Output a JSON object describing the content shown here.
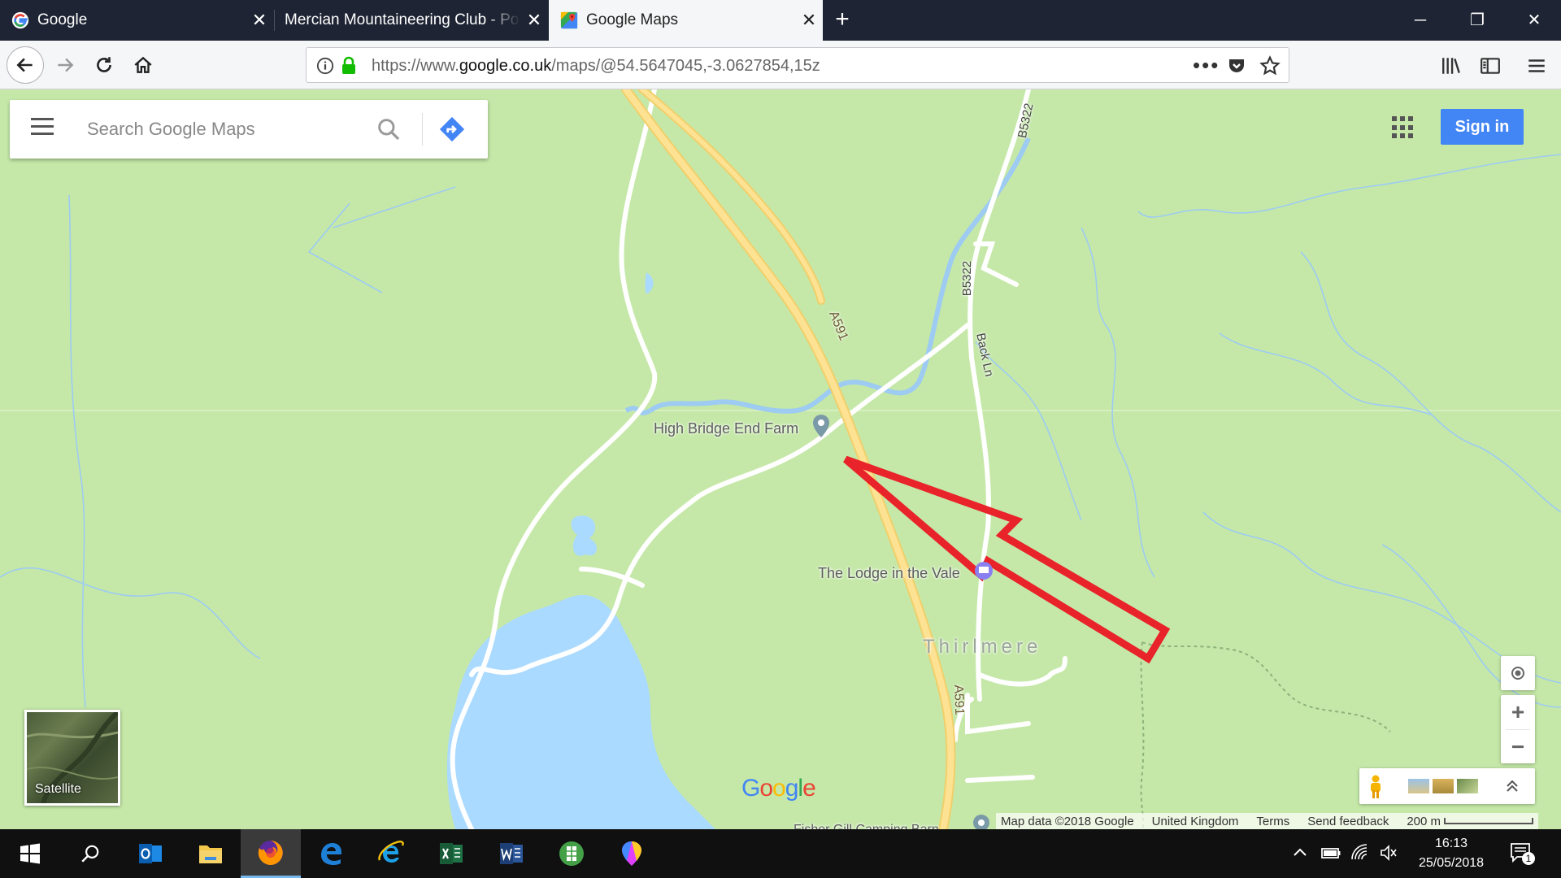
{
  "browser": {
    "tabs": [
      {
        "title": "Google",
        "favicon": "google-g-icon",
        "active": false
      },
      {
        "title": "Mercian Mountaineering Club - Pos",
        "favicon": "none",
        "active": false
      },
      {
        "title": "Google Maps",
        "favicon": "google-maps-icon",
        "active": true
      }
    ],
    "url_prefix": "https://www.",
    "url_domain": "google.co.uk",
    "url_path": "/maps/@54.5647045,-3.0627854,15z"
  },
  "maps": {
    "search_placeholder": "Search Google Maps",
    "sign_in": "Sign in",
    "satellite_label": "Satellite",
    "logo": "Google",
    "labels": {
      "high_bridge": "High Bridge End Farm",
      "lodge": "The Lodge in the Vale",
      "thirlmere": "Thirlmere",
      "a591_top": "A591",
      "a591_bottom": "A591",
      "b5322_top": "B5322",
      "b5322_mid": "B5322",
      "back_ln": "Back Ln",
      "camping": "Fisher Gill Camping Barn"
    },
    "footer": {
      "map_data": "Map data ©2018 Google",
      "region": "United Kingdom",
      "terms": "Terms",
      "feedback": "Send feedback",
      "scale": "200 m"
    },
    "annotation_color": "#e8232a"
  },
  "taskbar": {
    "time": "16:13",
    "date": "25/05/2018",
    "notification_count": "1",
    "apps": [
      "start-icon",
      "search-icon",
      "outlook-icon",
      "file-explorer-icon",
      "firefox-icon",
      "edge-icon",
      "internet-explorer-icon",
      "excel-icon",
      "word-icon",
      "spreadsheet-app-icon",
      "paint-3d-icon"
    ]
  }
}
